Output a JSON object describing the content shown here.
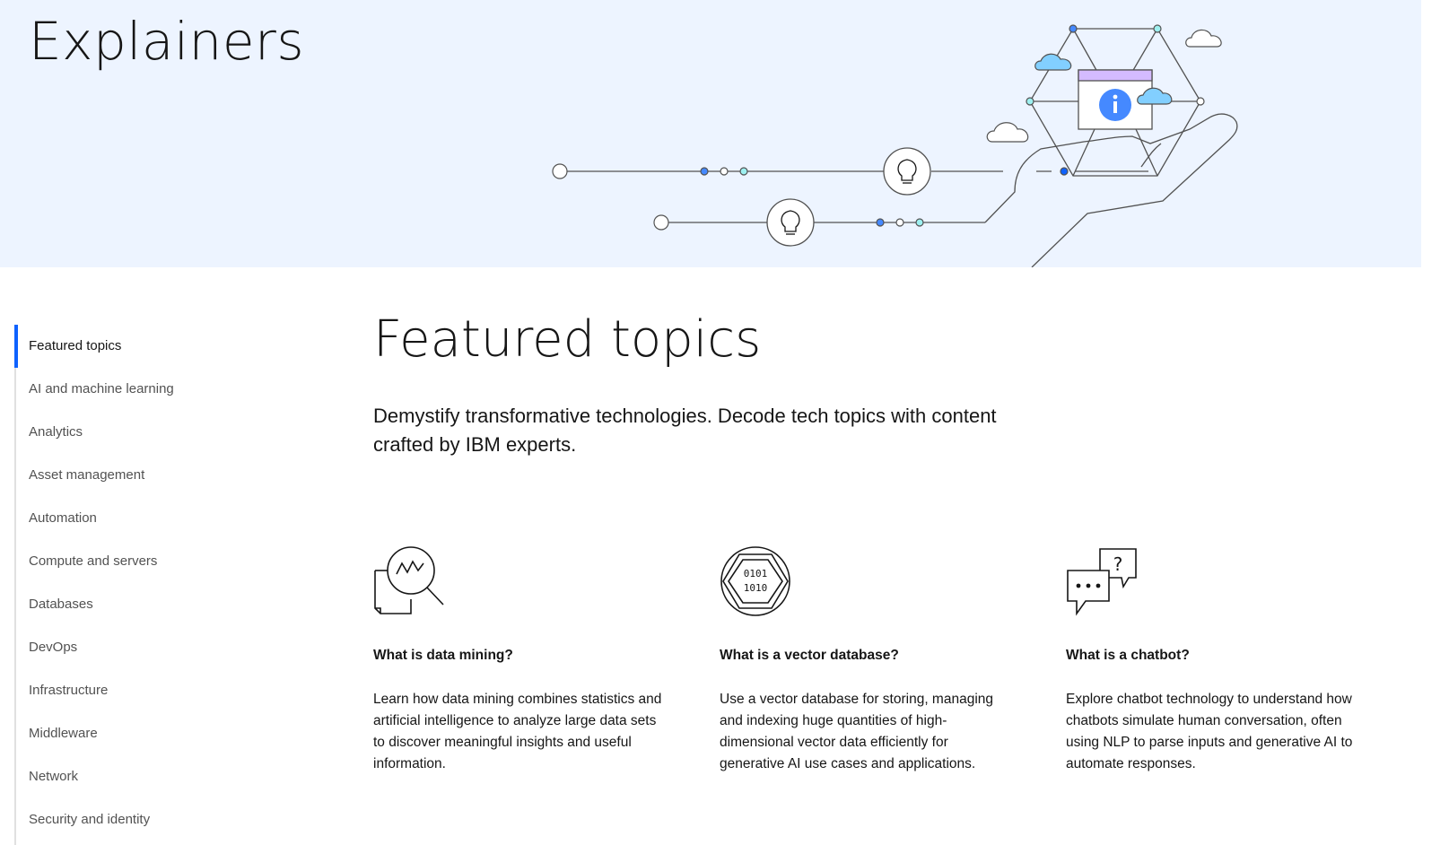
{
  "hero": {
    "title": "Explainers"
  },
  "sidebar": {
    "items": [
      {
        "label": "Featured topics",
        "active": true
      },
      {
        "label": "AI and machine learning"
      },
      {
        "label": "Analytics"
      },
      {
        "label": "Asset management"
      },
      {
        "label": "Automation"
      },
      {
        "label": "Compute and servers"
      },
      {
        "label": "Databases"
      },
      {
        "label": "DevOps"
      },
      {
        "label": "Infrastructure"
      },
      {
        "label": "Middleware"
      },
      {
        "label": "Network"
      },
      {
        "label": "Security and identity"
      }
    ]
  },
  "main": {
    "title": "Featured topics",
    "intro": "Demystify transformative technologies. Decode tech topics with content crafted by IBM experts.",
    "cards": [
      {
        "icon": "data-mining-icon",
        "title": "What is data mining?",
        "description": "Learn how data mining combines statistics and artificial intelligence to analyze large data sets to discover meaningful insights and useful information."
      },
      {
        "icon": "vector-database-icon",
        "title": "What is a vector database?",
        "description": "Use a vector database for storing, managing and indexing huge quantities of high-dimensional vector data efficiently for generative AI use cases and applications."
      },
      {
        "icon": "chatbot-icon",
        "title": "What is a chatbot?",
        "description": "Explore chatbot technology to understand how chatbots simulate human conversation, often using NLP to parse inputs and generative AI to automate responses."
      }
    ]
  },
  "colors": {
    "hero_bg": "#edf4ff",
    "accent": "#0f62fe",
    "text": "#161616",
    "nav_text": "#525252"
  }
}
